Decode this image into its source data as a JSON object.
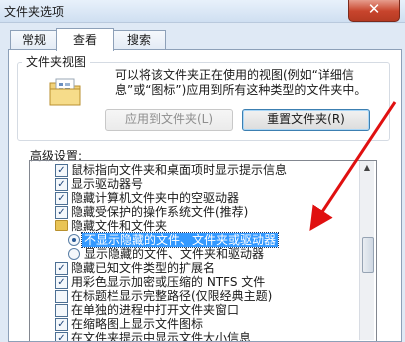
{
  "window": {
    "title": "文件夹选项",
    "close_symbol": "✕"
  },
  "tabs": [
    {
      "label": "常规"
    },
    {
      "label": "查看"
    },
    {
      "label": "搜索"
    }
  ],
  "folder_views": {
    "title": "文件夹视图",
    "description": "可以将该文件夹正在使用的视图(例如“详细信息”或“图标”)应用到所有这种类型的文件夹中。",
    "apply_button": "应用到文件夹(L)",
    "reset_button": "重置文件夹(R)"
  },
  "advanced": {
    "label": "高级设置:",
    "items": [
      {
        "type": "checkbox",
        "checked": true,
        "label": "鼠标指向文件夹和桌面项时显示提示信息"
      },
      {
        "type": "checkbox",
        "checked": true,
        "label": "显示驱动器号"
      },
      {
        "type": "checkbox",
        "checked": true,
        "label": "隐藏计算机文件夹中的空驱动器"
      },
      {
        "type": "checkbox",
        "checked": true,
        "label": "隐藏受保护的操作系统文件(推荐)"
      },
      {
        "type": "folder",
        "label": "隐藏文件和文件夹"
      },
      {
        "type": "radio",
        "checked": true,
        "selected": true,
        "label": "不显示隐藏的文件、文件夹或驱动器"
      },
      {
        "type": "radio",
        "checked": false,
        "label": "显示隐藏的文件、文件夹和驱动器"
      },
      {
        "type": "checkbox",
        "checked": true,
        "label": "隐藏已知文件类型的扩展名"
      },
      {
        "type": "checkbox",
        "checked": true,
        "label": "用彩色显示加密或压缩的 NTFS 文件"
      },
      {
        "type": "checkbox",
        "checked": false,
        "label": "在标题栏显示完整路径(仅限经典主题)"
      },
      {
        "type": "checkbox",
        "checked": false,
        "label": "在单独的进程中打开文件夹窗口"
      },
      {
        "type": "checkbox",
        "checked": true,
        "label": "在缩略图上显示文件图标"
      },
      {
        "type": "checkbox",
        "checked": true,
        "label": "在文件夹提示中显示文件大小信息"
      }
    ]
  },
  "colors": {
    "annotation_arrow": "#e01010",
    "selection": "#3399ff"
  }
}
